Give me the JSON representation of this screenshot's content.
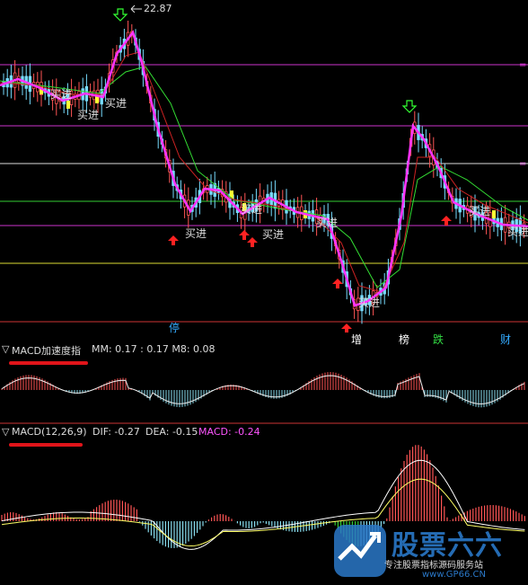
{
  "price_panel": {
    "peak_label": "22.87",
    "buy_label": "买进",
    "events": [
      {
        "key": "e1",
        "label": "停",
        "color": "#33aaff"
      },
      {
        "key": "e2",
        "label": "增",
        "color": "#ffffff"
      },
      {
        "key": "e3",
        "label": "榜",
        "color": "#ffffff"
      },
      {
        "key": "e4",
        "label": "跌",
        "color": "#33dd44"
      },
      {
        "key": "e5",
        "label": "财",
        "color": "#33aaff"
      }
    ]
  },
  "accel_panel": {
    "title": "MACD加速度指",
    "mm_text": "MM: 0.17  : 0.17  M8: 0.08"
  },
  "macd_panel": {
    "title": "MACD(12,26,9)",
    "dif_text": "DIF: -0.27",
    "dea_text": "DEA: -0.15",
    "macd_text": "MACD: -0.24"
  },
  "watermark": {
    "brand": "股票六六",
    "sub": "专注股票指标源码服务站",
    "url": "www.GP66.CN"
  },
  "colors": {
    "bg": "#000000",
    "magenta": "#ff33ff",
    "up": "#ff3333",
    "down": "#66ddff",
    "ma_green": "#33dd33",
    "ma_red": "#cc2222"
  }
}
